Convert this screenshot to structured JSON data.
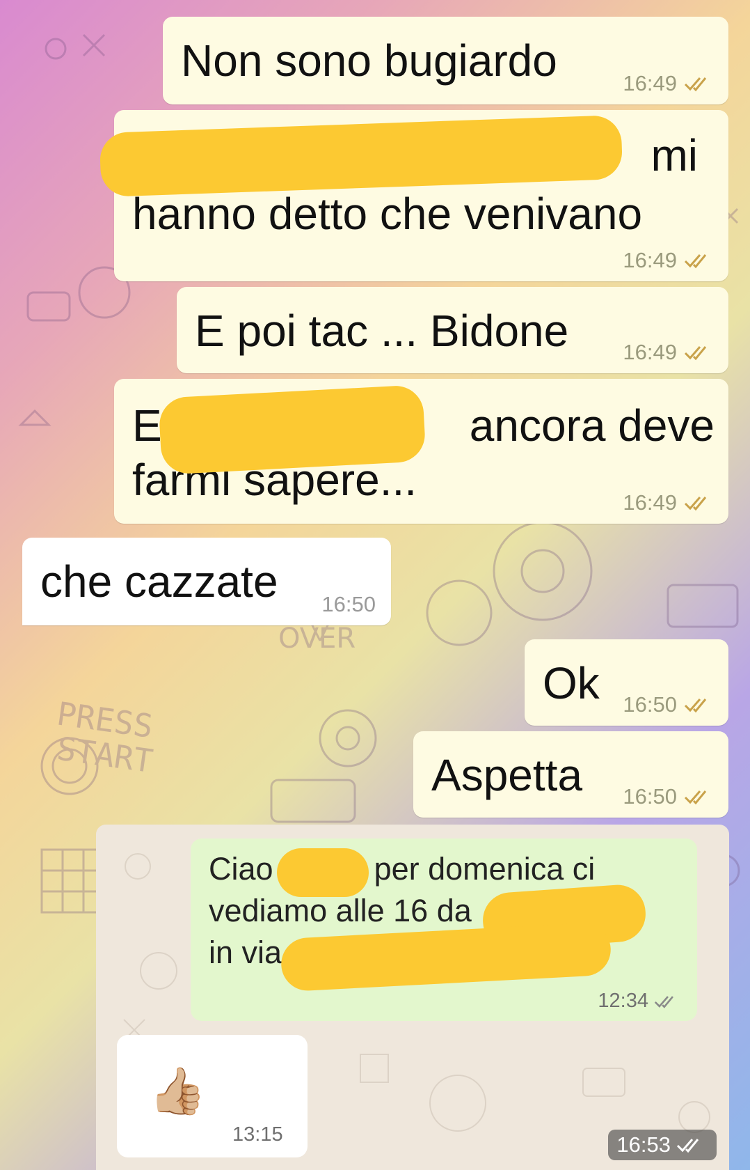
{
  "messages": [
    {
      "text": "Non sono bugiardo",
      "time": "16:49"
    },
    {
      "text_line1_visible": "mi",
      "text_line2": "hanno detto che venivano",
      "time": "16:49"
    },
    {
      "text": "E poi tac ... Bidone",
      "time": "16:49"
    },
    {
      "text_line1_start": "E",
      "text_line1_end": "ancora deve",
      "text_line2": "farmi sapere...",
      "time": "16:49"
    },
    {
      "text": "che cazzate",
      "time": "16:50"
    },
    {
      "text": "Ok",
      "time": "16:50"
    },
    {
      "text": "Aspetta",
      "time": "16:50"
    }
  ],
  "screenshot": {
    "outgoing": {
      "line1_start": "Ciao",
      "line1_end": ", per domenica ci",
      "line2": "vediamo alle 16 da",
      "line3": "in via",
      "time": "12:34"
    },
    "incoming": {
      "emoji": "👍🏼",
      "time": "13:15"
    },
    "image_time": "16:53"
  },
  "colors": {
    "outgoing_bubble": "#fefbe2",
    "incoming_bubble": "#ffffff",
    "redaction": "#fcc932",
    "tick": "#c9a24a",
    "wa_outgoing": "#e3f7cd"
  },
  "icons": [
    "double-check-icon",
    "thumbs-up-emoji"
  ]
}
